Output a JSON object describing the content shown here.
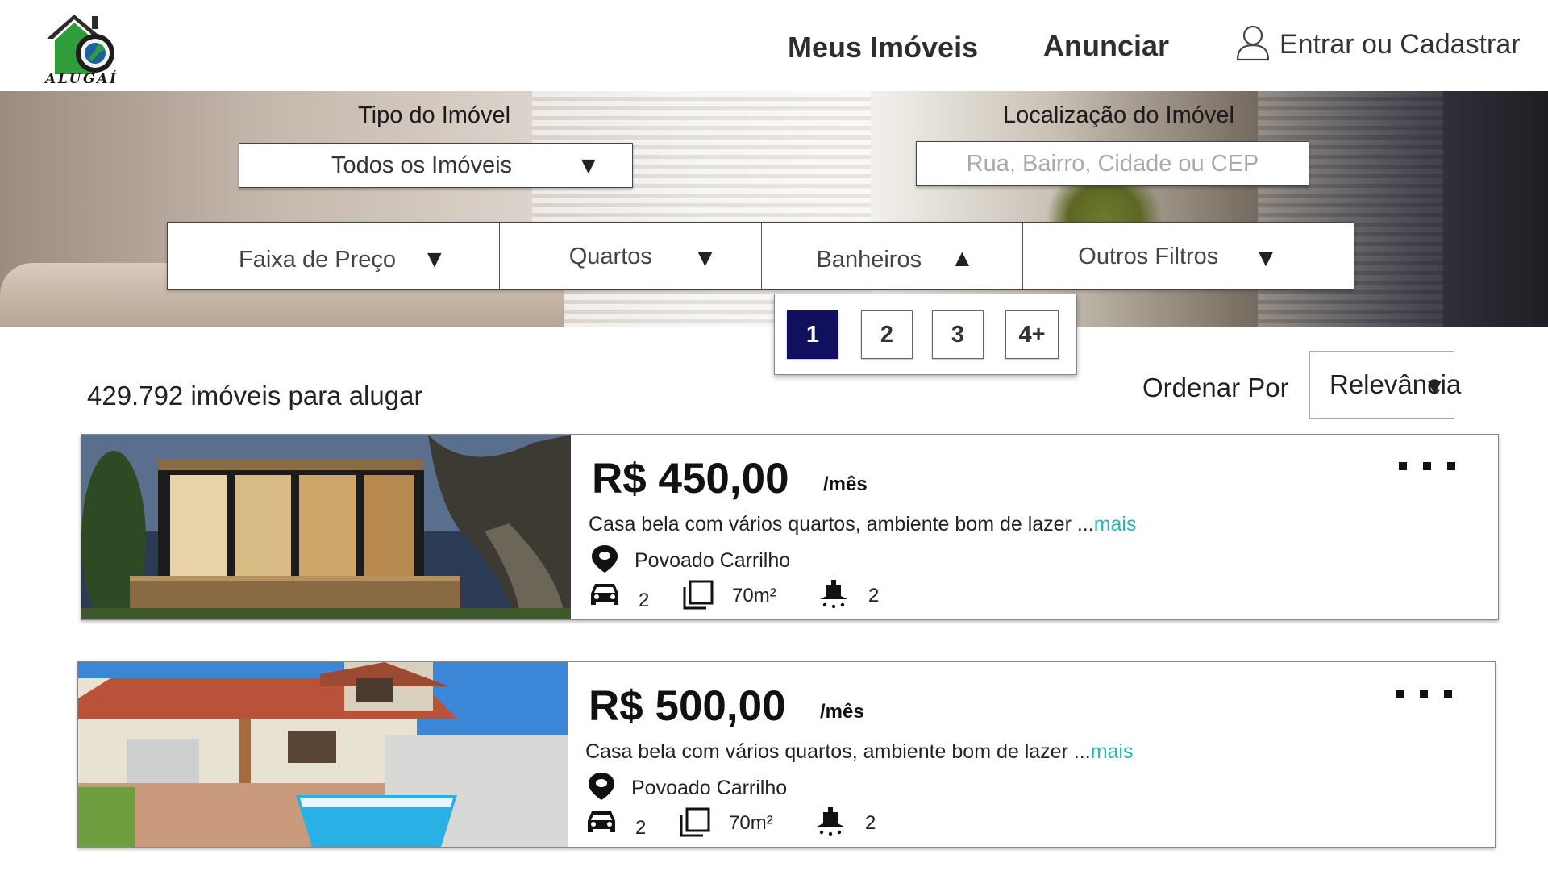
{
  "brand": {
    "logo_text": "ALUGAÍ"
  },
  "nav": {
    "meus_imoveis": "Meus Imóveis",
    "anunciar": "Anunciar",
    "login": "Entrar ou Cadastrar"
  },
  "search": {
    "tipo_label": "Tipo do Imóvel",
    "tipo_value": "Todos os Imóveis",
    "local_label": "Localização do Imóvel",
    "local_placeholder": "Rua, Bairro, Cidade ou CEP"
  },
  "filters": [
    {
      "label": "Faixa de Preço",
      "arrow": "▼"
    },
    {
      "label": "Quartos",
      "arrow": "▼"
    },
    {
      "label": "Banheiros",
      "arrow": "▲"
    },
    {
      "label": "Outros Filtros",
      "arrow": "▼"
    }
  ],
  "bathroom_options": {
    "options": [
      "1",
      "2",
      "3",
      "4+"
    ],
    "selected": "1"
  },
  "results": {
    "count_text": "429.792 imóveis para alugar",
    "order_label": "Ordenar Por",
    "order_value": "Relevância",
    "arrow": "▼"
  },
  "listings": [
    {
      "price": "R$ 450,00",
      "period": "/mês",
      "description": "Casa bela com vários quartos, ambiente bom de lazer ...",
      "more": "mais",
      "location": "Povoado Carrilho",
      "garage": "2",
      "area": "70m²",
      "bathrooms": "2"
    },
    {
      "price": "R$ 500,00",
      "period": "/mês",
      "description": "Casa bela com vários quartos, ambiente bom de lazer ...",
      "more": "mais",
      "location": "Povoado Carrilho",
      "garage": "2",
      "area": "70m²",
      "bathrooms": "2"
    }
  ],
  "colors": {
    "selected_option": "#10105e",
    "more_link": "#2ab3b0",
    "logo_green": "#2f9e3a"
  }
}
